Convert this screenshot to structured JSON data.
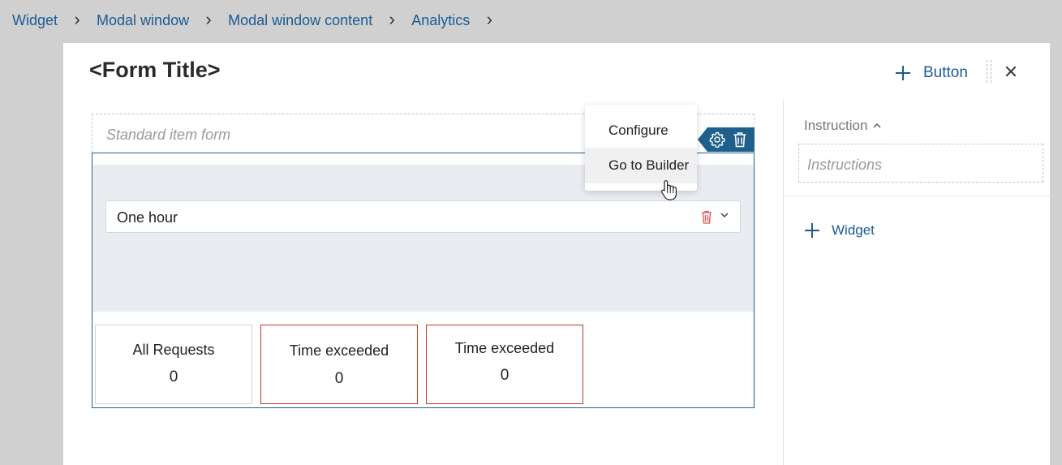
{
  "breadcrumb": {
    "items": [
      "Widget",
      "Modal window",
      "Modal window content",
      "Analytics"
    ]
  },
  "modal": {
    "title": "<Form Title>",
    "button_label": "Button"
  },
  "form": {
    "standard_label": "Standard item form",
    "select_value": "One hour",
    "tiles": [
      {
        "label": "All Requests",
        "value": "0"
      },
      {
        "label": "Time exceeded",
        "value": "0"
      },
      {
        "label": "Time exceeded",
        "value": "0"
      }
    ]
  },
  "context_menu": {
    "items": [
      "Configure",
      "Go to Builder"
    ]
  },
  "right_panel": {
    "instruction_label": "Instruction",
    "instruction_placeholder": "Instructions",
    "widget_label": "Widget"
  },
  "colors": {
    "accent": "#1a5c93",
    "toolbar": "#1f5f8b",
    "alert_border": "#c0392b",
    "danger_icon": "#d9534f"
  },
  "icons": [
    "plus-icon",
    "close-icon",
    "gear-icon",
    "trash-icon",
    "chevron-down-icon",
    "chevron-up-icon",
    "hand-cursor-icon"
  ]
}
